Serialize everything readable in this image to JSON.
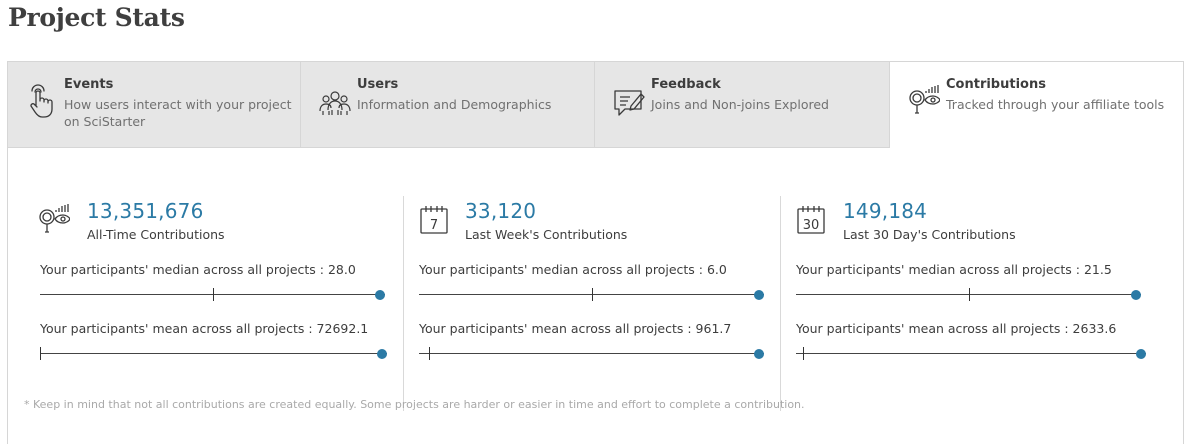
{
  "page": {
    "title": "Project Stats"
  },
  "tabs": [
    {
      "title": "Events",
      "description": "How users interact with your project on SciStarter",
      "icon": "hand-pointer-icon",
      "active": false
    },
    {
      "title": "Users",
      "description": "Information and Demographics",
      "icon": "people-group-icon",
      "active": false
    },
    {
      "title": "Feedback",
      "description": "Joins and Non-joins Explored",
      "icon": "chat-pencil-icon",
      "active": false
    },
    {
      "title": "Contributions",
      "description": "Tracked through your affiliate tools",
      "icon": "magnifier-chart-icon",
      "active": true
    }
  ],
  "stats": [
    {
      "value": "13,351,676",
      "label": "All-Time Contributions",
      "icon": "magnifier-chart-icon",
      "median_text": "Your participants' median across all projects : 28.0",
      "median_fraction": 0.5,
      "mean_text": "Your participants' mean across all projects : 72692.1",
      "mean_fraction": 0.0
    },
    {
      "value": "33,120",
      "label": "Last Week's Contributions",
      "icon": "calendar-7-icon",
      "icon_text": "7",
      "median_text": "Your participants' median across all projects : 6.0",
      "median_fraction": 0.5,
      "mean_text": "Your participants' mean across all projects : 961.7",
      "mean_fraction": 0.03
    },
    {
      "value": "149,184",
      "label": "Last 30 Day's Contributions",
      "icon": "calendar-30-icon",
      "icon_text": "30",
      "median_text": "Your participants' median across all projects : 21.5",
      "median_fraction": 0.5,
      "mean_text": "Your participants' mean across all projects : 2633.6",
      "mean_fraction": 0.02
    }
  ],
  "footnote": "* Keep in mind that not all contributions are created equally. Some projects are harder or easier in time and effort to complete a contribution.",
  "colors": {
    "accent": "#2b7aa5",
    "tab_inactive": "#e6e6e6",
    "border": "#d6d6d6"
  }
}
